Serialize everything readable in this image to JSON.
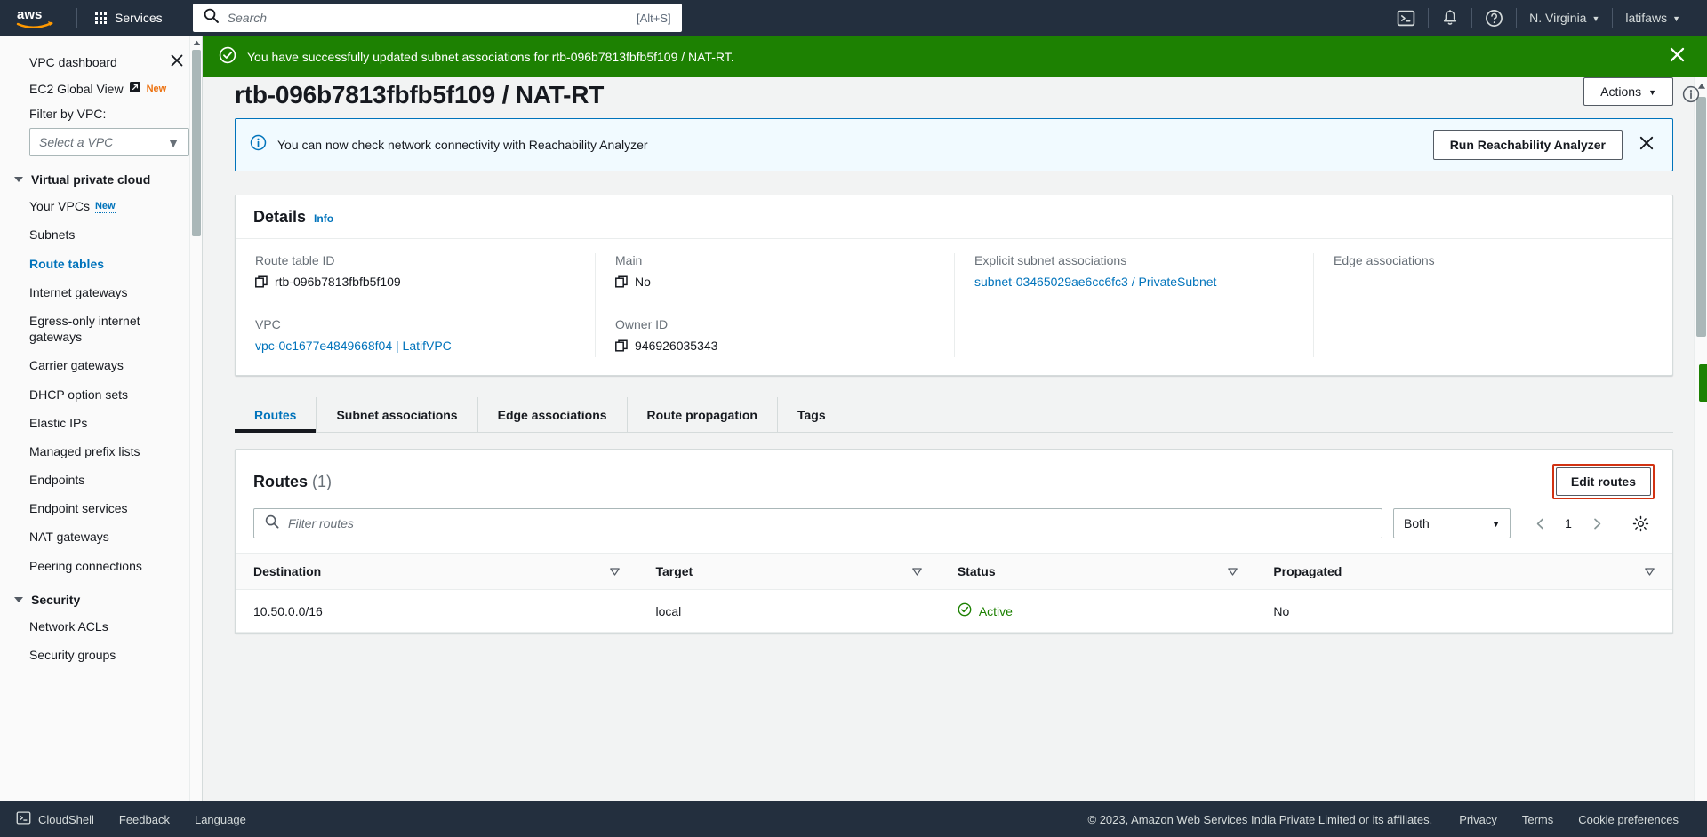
{
  "topnav": {
    "logo_alt": "aws",
    "services_label": "Services",
    "search_placeholder": "Search",
    "search_value": "",
    "search_shortcut": "[Alt+S]",
    "cloudshell_icon": "cloudshell-icon",
    "notifications_icon": "bell-icon",
    "help_icon": "question-circle-icon",
    "region_label": "N. Virginia",
    "account_label": "latifaws"
  },
  "sidebar": {
    "dashboard_label": "VPC dashboard",
    "close_icon": "close-icon",
    "global_view_label": "EC2 Global View",
    "global_view_badge": "New",
    "filter_label": "Filter by VPC:",
    "vpc_select_placeholder": "Select a VPC",
    "groups": [
      {
        "title": "Virtual private cloud",
        "items": [
          {
            "label": "Your VPCs",
            "badge": "New",
            "active": false
          },
          {
            "label": "Subnets",
            "active": false
          },
          {
            "label": "Route tables",
            "active": true
          },
          {
            "label": "Internet gateways",
            "active": false
          },
          {
            "label": "Egress-only internet gateways",
            "active": false
          },
          {
            "label": "Carrier gateways",
            "active": false
          },
          {
            "label": "DHCP option sets",
            "active": false
          },
          {
            "label": "Elastic IPs",
            "active": false
          },
          {
            "label": "Managed prefix lists",
            "active": false
          },
          {
            "label": "Endpoints",
            "active": false
          },
          {
            "label": "Endpoint services",
            "active": false
          },
          {
            "label": "NAT gateways",
            "active": false
          },
          {
            "label": "Peering connections",
            "active": false
          }
        ]
      },
      {
        "title": "Security",
        "items": [
          {
            "label": "Network ACLs",
            "active": false
          },
          {
            "label": "Security groups",
            "active": false
          }
        ]
      }
    ]
  },
  "flash": {
    "icon": "check-circle-icon",
    "message": "You have successfully updated subnet associations for rtb-096b7813fbfb5f109 / NAT-RT.",
    "close_icon": "close-icon"
  },
  "page": {
    "title": "rtb-096b7813fbfb5f109 / NAT-RT",
    "actions_label": "Actions"
  },
  "info_alert": {
    "icon": "info-circle-icon",
    "text": "You can now check network connectivity with Reachability Analyzer",
    "button_label": "Run Reachability Analyzer",
    "close_icon": "close-icon"
  },
  "details": {
    "title": "Details",
    "info_link": "Info",
    "fields": [
      {
        "label": "Route table ID",
        "value": "rtb-096b7813fbfb5f109",
        "copy": true,
        "link": false
      },
      {
        "label": "Main",
        "value": "No",
        "copy": true,
        "link": false
      },
      {
        "label": "Explicit subnet associations",
        "value": "subnet-03465029ae6cc6fc3 / PrivateSubnet",
        "copy": false,
        "link": true
      },
      {
        "label": "Edge associations",
        "value": "–",
        "copy": false,
        "link": false
      },
      {
        "label": "VPC",
        "value": "vpc-0c1677e4849668f04 | LatifVPC",
        "copy": false,
        "link": true
      },
      {
        "label": "Owner ID",
        "value": "946926035343",
        "copy": true,
        "link": false
      }
    ]
  },
  "tabs": [
    {
      "label": "Routes",
      "active": true
    },
    {
      "label": "Subnet associations",
      "active": false
    },
    {
      "label": "Edge associations",
      "active": false
    },
    {
      "label": "Route propagation",
      "active": false
    },
    {
      "label": "Tags",
      "active": false
    }
  ],
  "routes_panel": {
    "title": "Routes",
    "count": "(1)",
    "edit_button_label": "Edit routes",
    "highlight_color": "#d13212",
    "filter_placeholder": "Filter routes",
    "filter_value": "",
    "search_icon": "search-icon",
    "type_filter_value": "Both",
    "pager_prev_icon": "chevron-left-icon",
    "pager_next_icon": "chevron-right-icon",
    "pager_page": "1",
    "settings_icon": "gear-icon",
    "columns": [
      "Destination",
      "Target",
      "Status",
      "Propagated"
    ],
    "rows": [
      {
        "destination": "10.50.0.0/16",
        "target": "local",
        "status": "Active",
        "status_icon": "check-circle-icon",
        "propagated": "No"
      }
    ]
  },
  "footer": {
    "cloudshell_label": "CloudShell",
    "cloudshell_icon": "cloudshell-icon",
    "feedback_label": "Feedback",
    "language_label": "Language",
    "copyright": "© 2023, Amazon Web Services India Private Limited or its affiliates.",
    "links": [
      "Privacy",
      "Terms",
      "Cookie preferences"
    ]
  }
}
